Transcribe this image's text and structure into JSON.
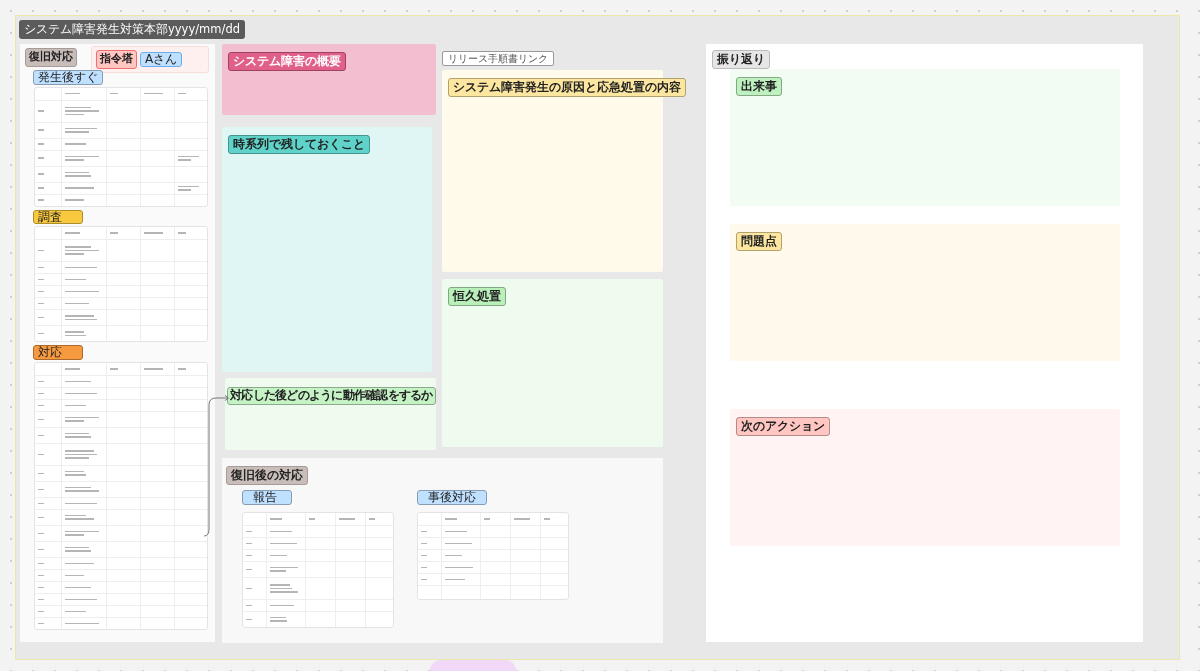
{
  "frame": {
    "title": "システム障害発生対策本部yyyy/mm/dd"
  },
  "left_panel": {
    "title": "復旧対応",
    "command": {
      "title": "指令塔",
      "person": "Aさん"
    },
    "sections": [
      {
        "title": "発生後すぐ",
        "color": "#bfe0ff"
      },
      {
        "title": "調査",
        "color": "#f8c93f"
      },
      {
        "title": "対応",
        "color": "#f6993f"
      }
    ]
  },
  "overview": {
    "title": "システム障害の概要",
    "color": "#e0608a"
  },
  "timeline": {
    "title": "時系列で残しておくこと",
    "color": "#5fd3c9"
  },
  "verification": {
    "title": "対応した後どのように動作確認をするか",
    "color": "#c6f3c6"
  },
  "link_button": {
    "label": "リリース手順書リンク"
  },
  "cause": {
    "title": "システム障害発生の原因と応急処置の内容",
    "color": "#fde7a0"
  },
  "permanent": {
    "title": "恒久処置",
    "color": "#b9efb9"
  },
  "after_recovery": {
    "title": "復旧後の対応",
    "sections": [
      {
        "title": "報告",
        "color": "#bfe0ff"
      },
      {
        "title": "事後対応",
        "color": "#bfe0ff"
      }
    ]
  },
  "retrospective": {
    "title": "振り返り",
    "notes": [
      {
        "title": "出来事",
        "color": "#bff0bf"
      },
      {
        "title": "問題点",
        "color": "#fde7a0"
      },
      {
        "title": "次のアクション",
        "color": "#ffc6c2"
      }
    ]
  }
}
